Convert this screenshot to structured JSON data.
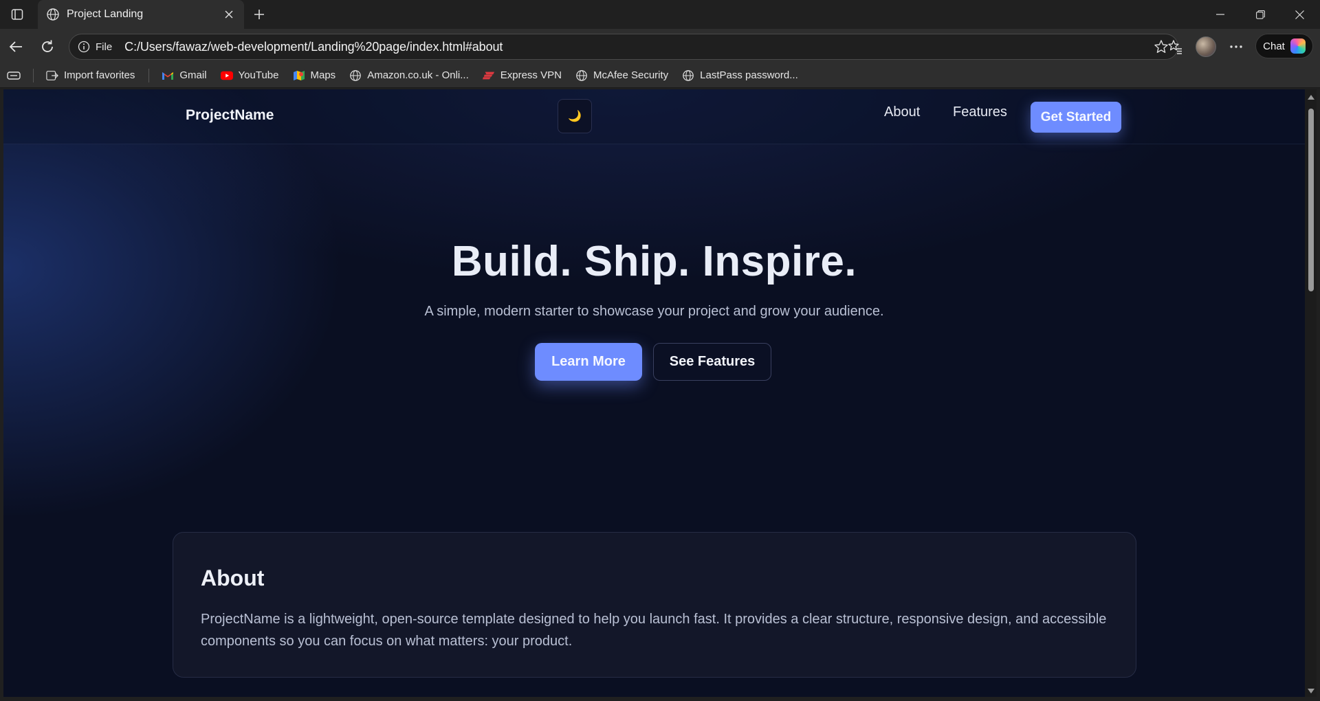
{
  "browser": {
    "tab_title": "Project Landing",
    "url_scheme": "File",
    "url": "C:/Users/fawaz/web-development/Landing%20page/index.html#about",
    "chat_label": "Chat"
  },
  "bookmarks": [
    {
      "label": "Import favorites",
      "icon": "import-icon"
    },
    {
      "label": "Gmail",
      "icon": "gmail-icon"
    },
    {
      "label": "YouTube",
      "icon": "youtube-icon"
    },
    {
      "label": "Maps",
      "icon": "maps-icon"
    },
    {
      "label": "Amazon.co.uk - Onli...",
      "icon": "globe-icon"
    },
    {
      "label": "Express VPN",
      "icon": "expressvpn-icon"
    },
    {
      "label": "McAfee Security",
      "icon": "globe-icon"
    },
    {
      "label": "LastPass password...",
      "icon": "globe-icon"
    }
  ],
  "site": {
    "brand": "ProjectName",
    "theme_icon": "🌙",
    "nav": {
      "about": "About",
      "features": "Features",
      "cta": "Get Started"
    },
    "hero": {
      "title": "Build. Ship. Inspire.",
      "subtitle": "A simple, modern starter to showcase your project and grow your audience.",
      "primary": "Learn More",
      "secondary": "See Features"
    },
    "about": {
      "heading": "About",
      "body": "ProjectName is a lightweight, open-source template designed to help you launch fast. It provides a clear structure, responsive design, and accessible components so you can focus on what matters: your product."
    }
  },
  "colors": {
    "accent": "#6e8cff",
    "page_bg": "#0a0f22",
    "card_bg": "#131729"
  }
}
